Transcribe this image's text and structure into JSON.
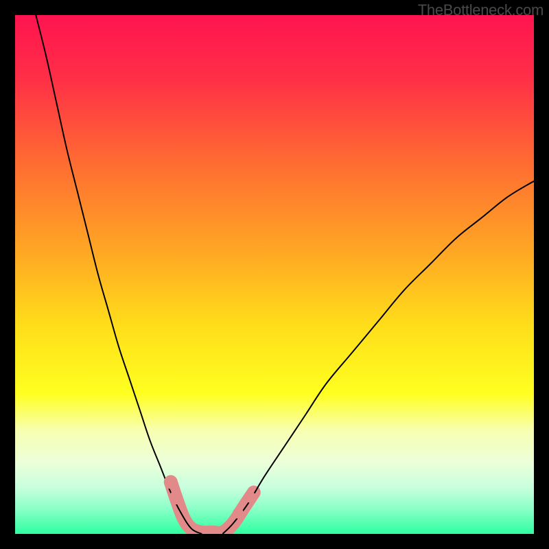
{
  "watermark": "TheBottleneck.com",
  "chart_data": {
    "type": "line",
    "title": "",
    "xlabel": "",
    "ylabel": "",
    "xlim": [
      0,
      100
    ],
    "ylim": [
      0,
      100
    ],
    "background_gradient": {
      "stops": [
        {
          "offset": 0,
          "color": "#ff1450"
        },
        {
          "offset": 12,
          "color": "#ff2e47"
        },
        {
          "offset": 28,
          "color": "#ff6a32"
        },
        {
          "offset": 45,
          "color": "#ffa524"
        },
        {
          "offset": 60,
          "color": "#ffde1a"
        },
        {
          "offset": 73,
          "color": "#ffff20"
        },
        {
          "offset": 80,
          "color": "#f8ffb0"
        },
        {
          "offset": 86,
          "color": "#ecffd8"
        },
        {
          "offset": 91,
          "color": "#c9ffde"
        },
        {
          "offset": 95,
          "color": "#8dffc8"
        },
        {
          "offset": 100,
          "color": "#2effa0"
        }
      ]
    },
    "series": [
      {
        "name": "left-curve",
        "stroke": "#000000",
        "stroke_width": 2,
        "points": [
          {
            "x": 4,
            "y": 100
          },
          {
            "x": 6,
            "y": 92
          },
          {
            "x": 8,
            "y": 83
          },
          {
            "x": 10,
            "y": 74
          },
          {
            "x": 12,
            "y": 66
          },
          {
            "x": 14,
            "y": 58
          },
          {
            "x": 16,
            "y": 50
          },
          {
            "x": 18,
            "y": 43
          },
          {
            "x": 20,
            "y": 36
          },
          {
            "x": 22,
            "y": 30
          },
          {
            "x": 24,
            "y": 24
          },
          {
            "x": 26,
            "y": 18
          },
          {
            "x": 28,
            "y": 13
          },
          {
            "x": 30,
            "y": 8
          },
          {
            "x": 32,
            "y": 4
          },
          {
            "x": 34,
            "y": 1
          },
          {
            "x": 36,
            "y": 0
          }
        ]
      },
      {
        "name": "right-curve",
        "stroke": "#000000",
        "stroke_width": 2,
        "points": [
          {
            "x": 40,
            "y": 0
          },
          {
            "x": 42,
            "y": 2
          },
          {
            "x": 45,
            "y": 6
          },
          {
            "x": 48,
            "y": 11
          },
          {
            "x": 52,
            "y": 17
          },
          {
            "x": 56,
            "y": 23
          },
          {
            "x": 60,
            "y": 29
          },
          {
            "x": 65,
            "y": 35
          },
          {
            "x": 70,
            "y": 41
          },
          {
            "x": 75,
            "y": 47
          },
          {
            "x": 80,
            "y": 52
          },
          {
            "x": 85,
            "y": 57
          },
          {
            "x": 90,
            "y": 61
          },
          {
            "x": 95,
            "y": 65
          },
          {
            "x": 100,
            "y": 68
          }
        ]
      },
      {
        "name": "bottom-band",
        "stroke": "#e28a8a",
        "stroke_width": 20,
        "stroke_linecap": "round",
        "points": [
          {
            "x": 30,
            "y": 10
          },
          {
            "x": 31,
            "y": 7
          },
          {
            "x": 32.5,
            "y": 3
          },
          {
            "x": 34,
            "y": 1
          },
          {
            "x": 36,
            "y": 0.3
          },
          {
            "x": 38,
            "y": 0.3
          },
          {
            "x": 40,
            "y": 0.3
          },
          {
            "x": 42,
            "y": 2
          },
          {
            "x": 44,
            "y": 5
          },
          {
            "x": 46,
            "y": 8
          }
        ]
      }
    ],
    "markers": [
      {
        "x": 30,
        "y": 10,
        "r": 10,
        "color": "#e28a8a"
      },
      {
        "x": 31,
        "y": 7,
        "r": 10,
        "color": "#e28a8a"
      },
      {
        "x": 43,
        "y": 4,
        "r": 8,
        "color": "#e28a8a"
      },
      {
        "x": 45.5,
        "y": 7,
        "r": 8,
        "color": "#e28a8a"
      }
    ]
  }
}
